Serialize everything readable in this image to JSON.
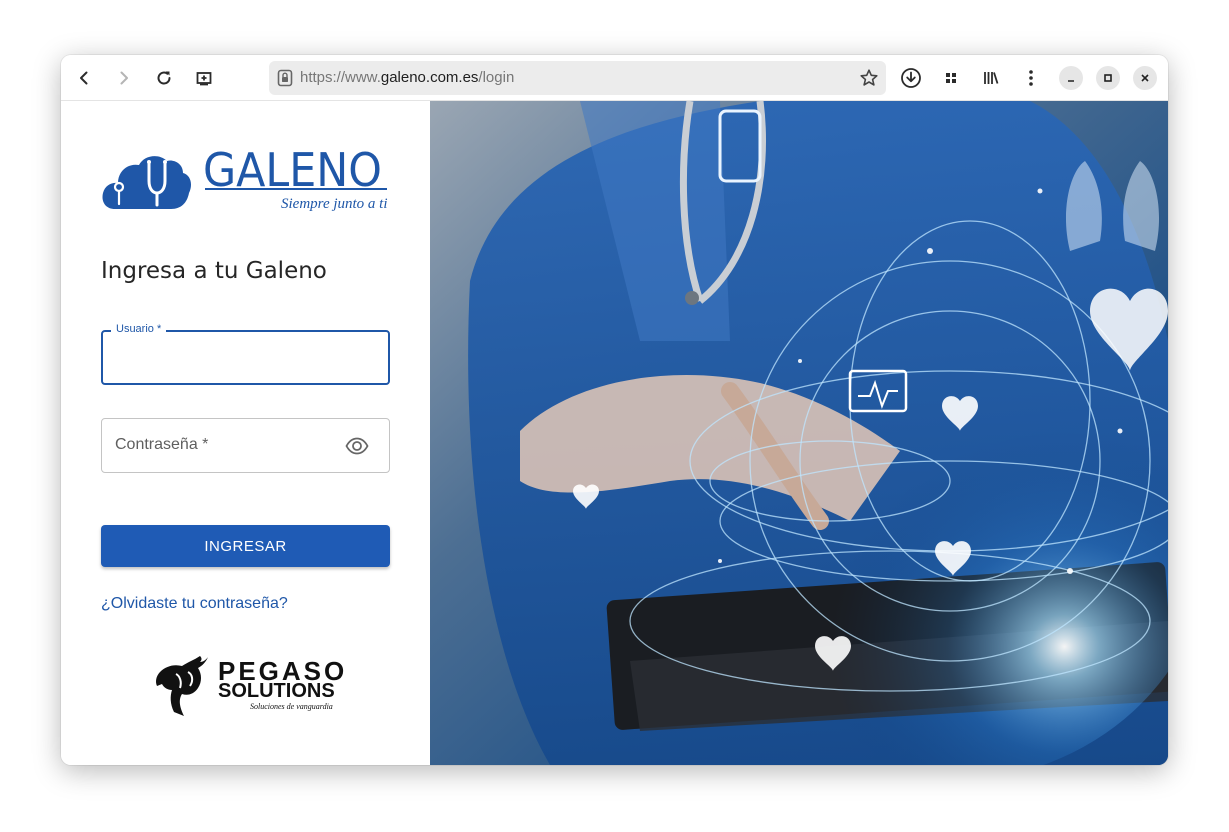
{
  "browser": {
    "url_prefix": "https://www.",
    "url_domain": "galeno.com.es",
    "url_path": "/login"
  },
  "brand": {
    "name": "GALENO",
    "tagline": "Siempre junto a ti",
    "color": "#1f57a8"
  },
  "login": {
    "heading": "Ingresa a tu Galeno",
    "username_label": "Usuario *",
    "username_value": "",
    "password_placeholder": "Contraseña *",
    "submit_label": "INGRESAR",
    "forgot_label": "¿Olvidaste tu contraseña?",
    "button_color": "#1f5bb5"
  },
  "footer_logo": {
    "name": "PEGASO",
    "sub": "SOLUTIONS",
    "tagline": "Soluciones de vanguardia"
  },
  "icons": {
    "back": "arrow-left-icon",
    "forward": "arrow-right-icon",
    "reload": "reload-icon",
    "screenshot": "screenshot-icon",
    "lock": "lock-icon",
    "bookmark": "star-icon",
    "downloads": "download-icon",
    "extensions": "grid-icon",
    "library": "library-icon",
    "menu": "kebab-menu-icon",
    "minimize": "minimize-icon",
    "maximize": "maximize-icon",
    "close": "close-icon",
    "password_toggle": "eye-icon"
  }
}
